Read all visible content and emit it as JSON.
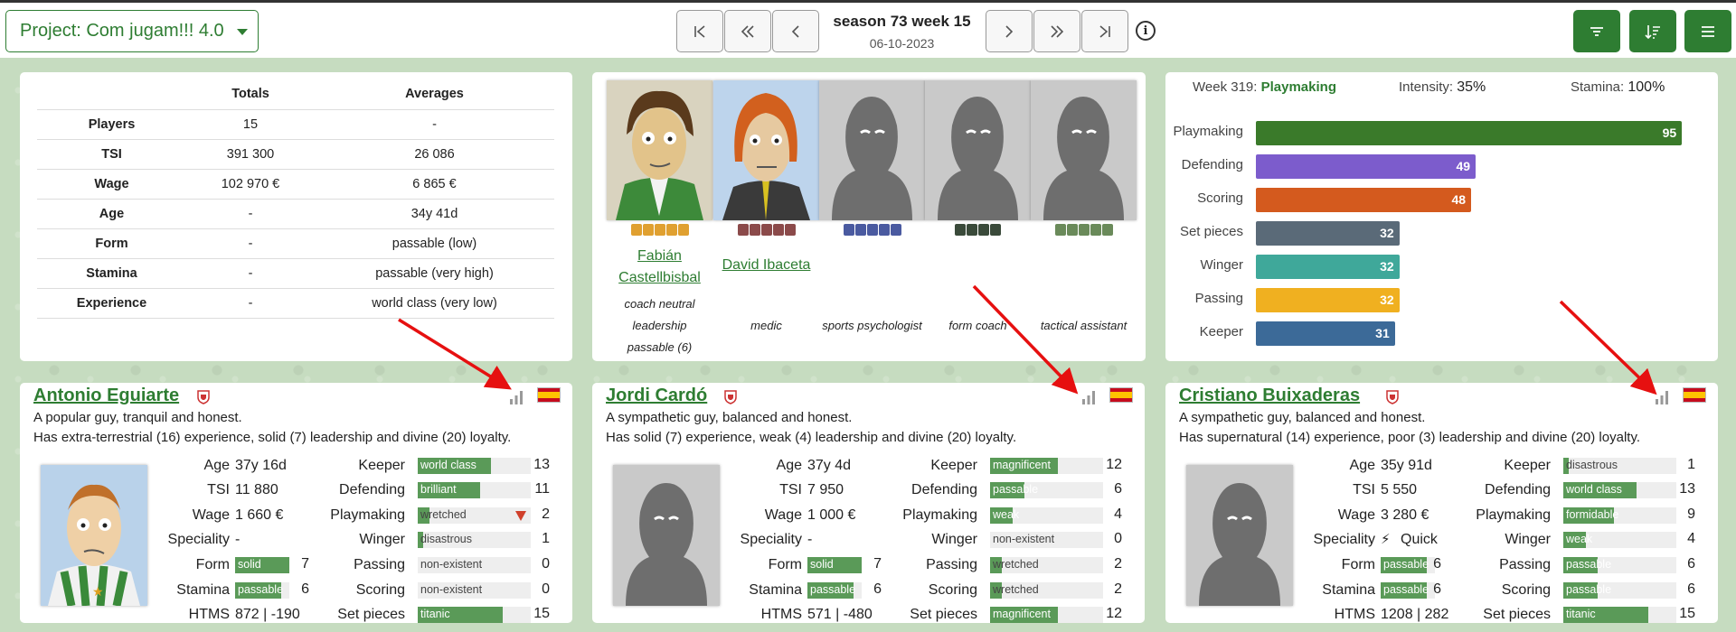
{
  "topbar": {
    "project_label": "Project: Com jugam!!! 4.0",
    "season": "season 73 week 15",
    "date": "06-10-2023"
  },
  "stats": {
    "headers": [
      "",
      "Totals",
      "Averages"
    ],
    "rows": [
      {
        "label": "Players",
        "total": "15",
        "avg": "-"
      },
      {
        "label": "TSI",
        "total": "391 300",
        "avg": "26 086"
      },
      {
        "label": "Wage",
        "total": "102 970 €",
        "avg": "6 865 €"
      },
      {
        "label": "Age",
        "total": "-",
        "avg": "34y 41d"
      },
      {
        "label": "Form",
        "total": "-",
        "avg": "passable (low)"
      },
      {
        "label": "Stamina",
        "total": "-",
        "avg": "passable (very high)"
      },
      {
        "label": "Experience",
        "total": "-",
        "avg": "world class (very low)"
      }
    ]
  },
  "staff": [
    {
      "name_line1": "Fabián",
      "name_line2": "Castellbisbal",
      "role1": "coach neutral",
      "role2": "leadership",
      "role3": "passable (6)",
      "level_color": "#e0a030"
    },
    {
      "name_line1": "David Ibaceta",
      "name_line2": "",
      "role1": "medic",
      "role2": "",
      "role3": "",
      "level_color": "#8b4a4a"
    },
    {
      "name_line1": "",
      "name_line2": "",
      "role1": "sports psychologist",
      "role2": "",
      "role3": "",
      "level_color": "#4a5aa0"
    },
    {
      "name_line1": "",
      "name_line2": "",
      "role1": "form coach",
      "role2": "",
      "role3": "",
      "level_color": "#3a4a3a"
    },
    {
      "name_line1": "",
      "name_line2": "",
      "role1": "tactical assistant",
      "role2": "",
      "role3": "",
      "level_color": "#6a8a5a"
    }
  ],
  "training": {
    "week_label": "Week 319:",
    "week_type": "Playmaking",
    "intensity_label": "Intensity:",
    "intensity": "35%",
    "stamina_label": "Stamina:",
    "stamina": "100%",
    "bars": [
      {
        "label": "Playmaking",
        "value": 95,
        "text": "95",
        "color": "#3a7a2a"
      },
      {
        "label": "Defending",
        "value": 49,
        "text": "49",
        "color": "#7c5ccc"
      },
      {
        "label": "Scoring",
        "value": 48,
        "text": "48",
        "color": "#d45a1e"
      },
      {
        "label": "Set pieces",
        "value": 32,
        "text": "32",
        "color": "#5a6a78"
      },
      {
        "label": "Winger",
        "value": 32,
        "text": "32",
        "color": "#3fa89a"
      },
      {
        "label": "Passing",
        "value": 32,
        "text": "32",
        "color": "#f0b020"
      },
      {
        "label": "Keeper",
        "value": 31,
        "text": "31",
        "color": "#3c6a98"
      }
    ]
  },
  "players": [
    {
      "name": "Antonio Eguiarte",
      "desc1": "A popular guy, tranquil and honest.",
      "desc2": "Has extra-terrestrial (16) experience, solid (7) leadership and divine (20) loyalty.",
      "age": "37y 16d",
      "tsi": "11 880",
      "wage": "1 660 €",
      "speciality": "-",
      "form_label": "solid",
      "form_num": "7",
      "form_frac": 0.7,
      "stamina_label": "passable",
      "stamina_num": "6",
      "stamina_frac": 0.6,
      "htms": "872 | -190",
      "skills": [
        {
          "name": "Keeper",
          "label": "world class",
          "num": "13",
          "frac": 0.65
        },
        {
          "name": "Defending",
          "label": "brilliant",
          "num": "11",
          "frac": 0.55
        },
        {
          "name": "Playmaking",
          "label": "wretched",
          "num": "2",
          "frac": 0.1
        },
        {
          "name": "Winger",
          "label": "disastrous",
          "num": "1",
          "frac": 0.05
        },
        {
          "name": "Passing",
          "label": "non-existent",
          "num": "0",
          "frac": 0.0
        },
        {
          "name": "Scoring",
          "label": "non-existent",
          "num": "0",
          "frac": 0.0
        },
        {
          "name": "Set pieces",
          "label": "titanic",
          "num": "15",
          "frac": 0.75
        }
      ]
    },
    {
      "name": "Jordi Cardó",
      "desc1": "A sympathetic guy, balanced and honest.",
      "desc2": "Has solid (7) experience, weak (4) leadership and divine (20) loyalty.",
      "age": "37y 4d",
      "tsi": "7 950",
      "wage": "1 000 €",
      "speciality": "-",
      "form_label": "solid",
      "form_num": "7",
      "form_frac": 0.7,
      "stamina_label": "passable",
      "stamina_num": "6",
      "stamina_frac": 0.6,
      "htms": "571 | -480",
      "skills": [
        {
          "name": "Keeper",
          "label": "magnificent",
          "num": "12",
          "frac": 0.6
        },
        {
          "name": "Defending",
          "label": "passable",
          "num": "6",
          "frac": 0.3
        },
        {
          "name": "Playmaking",
          "label": "weak",
          "num": "4",
          "frac": 0.2
        },
        {
          "name": "Winger",
          "label": "non-existent",
          "num": "0",
          "frac": 0.0
        },
        {
          "name": "Passing",
          "label": "wretched",
          "num": "2",
          "frac": 0.1
        },
        {
          "name": "Scoring",
          "label": "wretched",
          "num": "2",
          "frac": 0.1
        },
        {
          "name": "Set pieces",
          "label": "magnificent",
          "num": "12",
          "frac": 0.6
        }
      ]
    },
    {
      "name": "Cristiano Buixaderas",
      "desc1": "A sympathetic guy, balanced and honest.",
      "desc2": "Has supernatural (14) experience, poor (3) leadership and divine (20) loyalty.",
      "age": "35y 91d",
      "tsi": "5 550",
      "wage": "3 280 €",
      "speciality": "Quick",
      "form_label": "passable",
      "form_num": "6",
      "form_frac": 0.6,
      "stamina_label": "passable",
      "stamina_num": "6",
      "stamina_frac": 0.6,
      "htms": "1208 | 282",
      "skills": [
        {
          "name": "Keeper",
          "label": "disastrous",
          "num": "1",
          "frac": 0.05
        },
        {
          "name": "Defending",
          "label": "world class",
          "num": "13",
          "frac": 0.65
        },
        {
          "name": "Playmaking",
          "label": "formidable",
          "num": "9",
          "frac": 0.45
        },
        {
          "name": "Winger",
          "label": "weak",
          "num": "4",
          "frac": 0.2
        },
        {
          "name": "Passing",
          "label": "passable",
          "num": "6",
          "frac": 0.3
        },
        {
          "name": "Scoring",
          "label": "passable",
          "num": "6",
          "frac": 0.3
        },
        {
          "name": "Set pieces",
          "label": "titanic",
          "num": "15",
          "frac": 0.75
        }
      ]
    }
  ],
  "labels": {
    "age": "Age",
    "tsi": "TSI",
    "wage": "Wage",
    "speciality": "Speciality",
    "form": "Form",
    "stamina": "Stamina",
    "htms": "HTMS"
  },
  "icons": {
    "first": "skip-to-first-icon",
    "rewind": "double-chevron-left-icon",
    "prev": "chevron-left-icon",
    "next": "chevron-right-icon",
    "forward": "double-chevron-right-icon",
    "last": "skip-to-last-icon",
    "info": "info-icon",
    "filter": "filter-icon",
    "sort": "sort-icon",
    "menu": "menu-icon"
  }
}
